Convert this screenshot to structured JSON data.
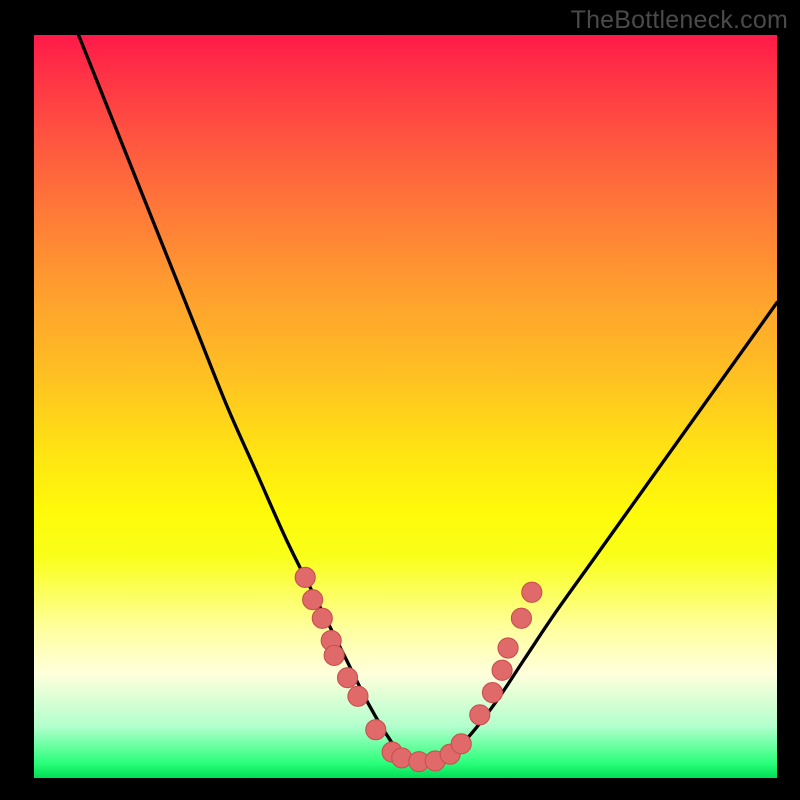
{
  "watermark": "TheBottleneck.com",
  "colors": {
    "frame": "#000000",
    "curve_stroke": "#000000",
    "dot_fill": "#e06a6a",
    "dot_stroke": "#c84f4f"
  },
  "chart_data": {
    "type": "line",
    "title": "",
    "xlabel": "",
    "ylabel": "",
    "xlim": [
      0,
      100
    ],
    "ylim": [
      0,
      100
    ],
    "grid": false,
    "series": [
      {
        "name": "bottleneck-curve",
        "x": [
          6,
          10,
          14,
          18,
          22,
          26,
          30,
          34,
          38,
          42,
          45,
          48,
          50,
          52,
          55,
          58,
          62,
          66,
          70,
          75,
          80,
          85,
          90,
          95,
          100
        ],
        "y": [
          100,
          90,
          80,
          70,
          60,
          50,
          41,
          32,
          24,
          16,
          10,
          5,
          2.5,
          2,
          2.5,
          5,
          10,
          16,
          22,
          29,
          36,
          43,
          50,
          57,
          64
        ]
      }
    ],
    "markers": [
      {
        "x": 36.5,
        "y": 27
      },
      {
        "x": 37.5,
        "y": 24
      },
      {
        "x": 38.8,
        "y": 21.5
      },
      {
        "x": 40.0,
        "y": 18.5
      },
      {
        "x": 40.4,
        "y": 16.5
      },
      {
        "x": 42.2,
        "y": 13.5
      },
      {
        "x": 43.6,
        "y": 11
      },
      {
        "x": 46.0,
        "y": 6.5
      },
      {
        "x": 48.2,
        "y": 3.5
      },
      {
        "x": 49.5,
        "y": 2.7
      },
      {
        "x": 51.8,
        "y": 2.2
      },
      {
        "x": 54.0,
        "y": 2.3
      },
      {
        "x": 56.0,
        "y": 3.2
      },
      {
        "x": 57.5,
        "y": 4.6
      },
      {
        "x": 60.0,
        "y": 8.5
      },
      {
        "x": 61.7,
        "y": 11.5
      },
      {
        "x": 63.0,
        "y": 14.5
      },
      {
        "x": 63.8,
        "y": 17.5
      },
      {
        "x": 65.6,
        "y": 21.5
      },
      {
        "x": 67.0,
        "y": 25
      }
    ],
    "marker_radius": 1.35
  }
}
